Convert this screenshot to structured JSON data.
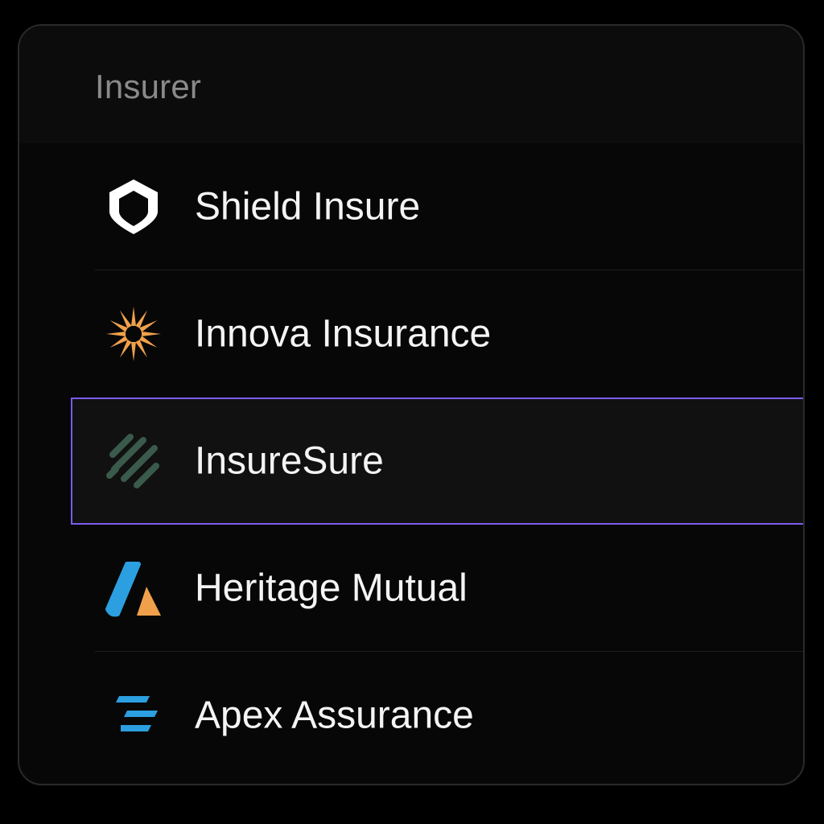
{
  "dropdown": {
    "header_label": "Insurer",
    "selected_index": 2,
    "accent_color": "#7b5cf0",
    "options": [
      {
        "label": "Shield Insure",
        "icon": "shield-icon",
        "color": "#ffffff"
      },
      {
        "label": "Innova Insurance",
        "icon": "sunburst-icon",
        "color": "#f0a04b"
      },
      {
        "label": "InsureSure",
        "icon": "slanted-stripes-icon",
        "color": "#3a5a4c"
      },
      {
        "label": "Heritage Mutual",
        "icon": "mountain-a-icon",
        "color": "#2b9fe0"
      },
      {
        "label": "Apex Assurance",
        "icon": "speed-lines-icon",
        "color": "#2b9fe0"
      }
    ]
  }
}
